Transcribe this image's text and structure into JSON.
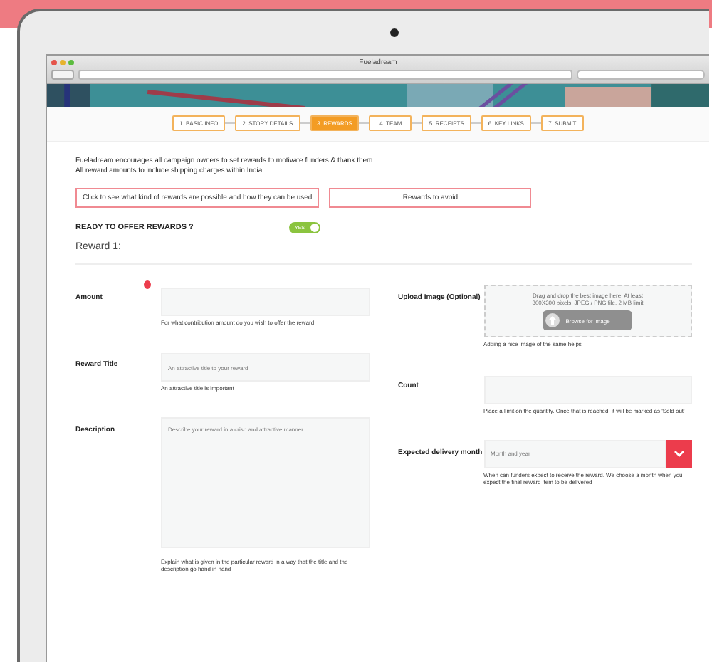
{
  "window": {
    "title": "Fueladream"
  },
  "steps": [
    {
      "label": "1. BASIC INFO",
      "selected": false
    },
    {
      "label": "2. STORY DETAILS",
      "selected": false
    },
    {
      "label": "3. REWARDS",
      "selected": true
    },
    {
      "label": "4. TEAM",
      "selected": false
    },
    {
      "label": "5. RECEIPTS",
      "selected": false
    },
    {
      "label": "6. KEY LINKS",
      "selected": false
    },
    {
      "label": "7. SUBMIT",
      "selected": false
    }
  ],
  "intro": [
    "Fueladream encourages all campaign owners to set rewards to motivate funders & thank them.",
    "All reward amounts to include shipping charges within India."
  ],
  "info_buttons": [
    "Click to see what kind of rewards are possible and how they can be used",
    "Rewards to avoid"
  ],
  "offer_rewards": {
    "label": "READY TO OFFER REWARDS ?",
    "toggle": "YES",
    "on": true
  },
  "reward_heading": "Reward 1:",
  "left_fields": [
    {
      "kind": "text",
      "label": "Amount",
      "help": "For what contribution amount do you wish to offer the reward"
    },
    {
      "kind": "text",
      "label": "Reward Title",
      "placeholder": "An attractive title to your reward",
      "help": "An attractive title is important"
    },
    {
      "kind": "textarea",
      "label": "Description",
      "placeholder": "Describe your reward in a crisp and attractive manner",
      "help": "Explain what is given in the particular reward in a way that the title and the description go hand in hand"
    }
  ],
  "right_fields": [
    {
      "kind": "upload",
      "label": "Upload Image (Optional)",
      "drop_text": "Drag and drop the best image here. At least 300X300 pixels. JPEG / PNG file, 2 MB limit",
      "button": "Browse for image",
      "help": "Adding a nice image of the same helps"
    },
    {
      "kind": "text",
      "label": "Count",
      "help": "Place a limit on the quantity. Once that is reached, it will be marked as 'Sold out'"
    },
    {
      "kind": "select",
      "label": "Expected delivery month",
      "placeholder": "Month and year",
      "help": "When can funders expect to receive the reward. We choose a month when you expect the final reward item to be delivered"
    }
  ]
}
